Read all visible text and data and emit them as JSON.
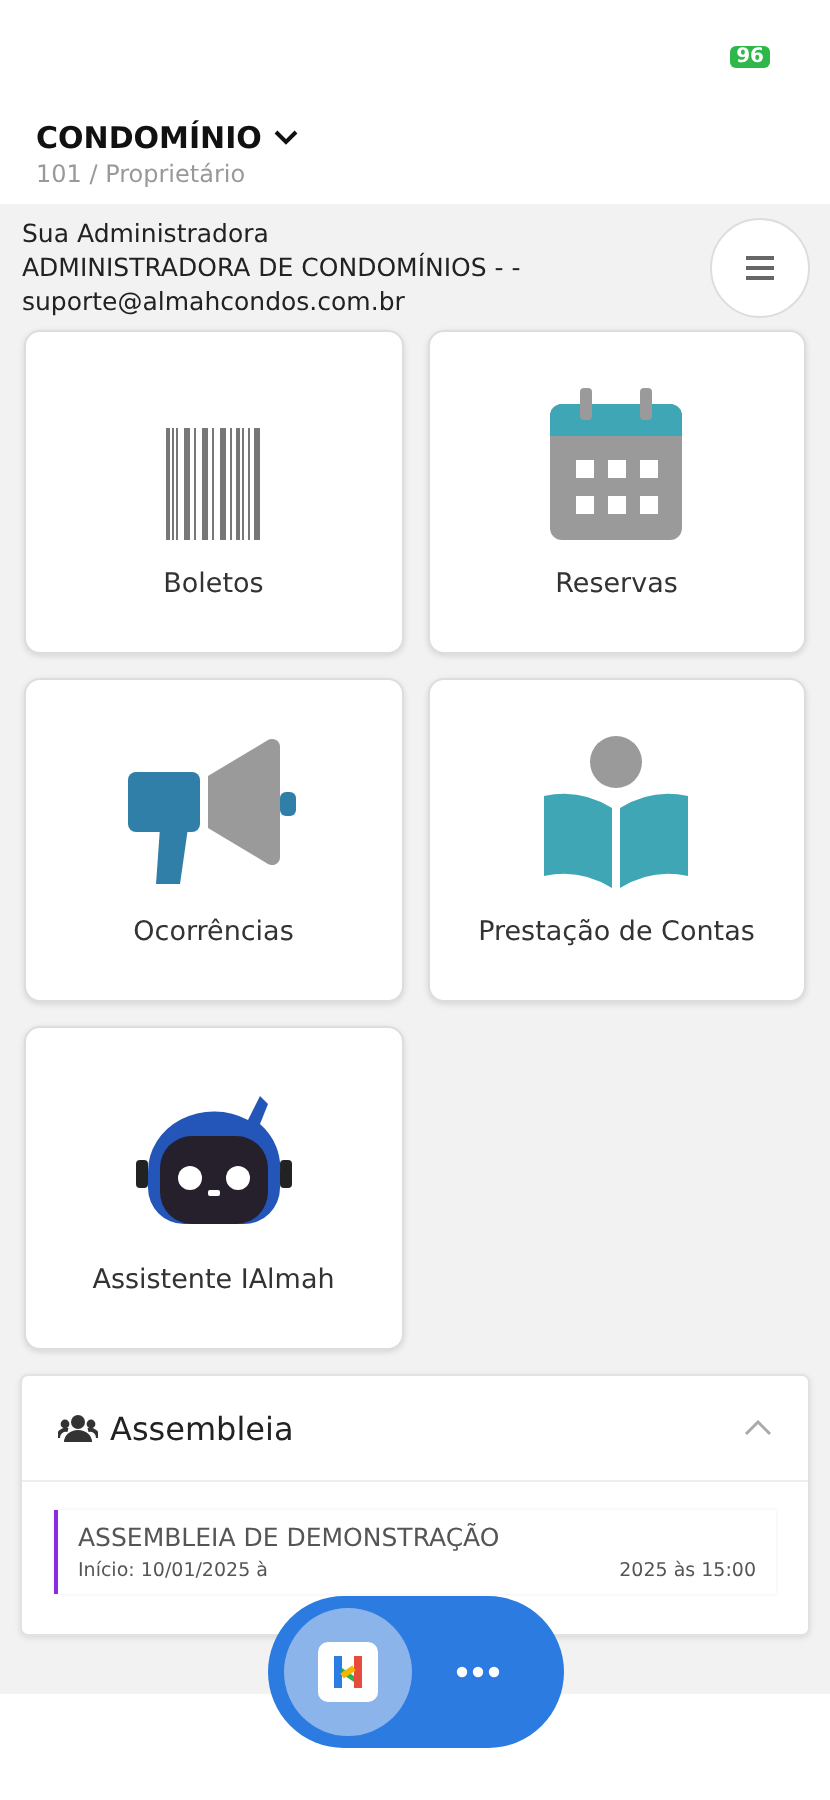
{
  "status_bar": {
    "battery": "96"
  },
  "header": {
    "title": "CONDOMÍNIO",
    "subtitle": "101 / Proprietário"
  },
  "administrator": {
    "label": "Sua Administradora",
    "name": "ADMINISTRADORA DE CONDOMÍNIOS - -",
    "email": "suporte@almahcondos.com.br"
  },
  "tiles": [
    {
      "kind": "barcode",
      "label": "Boletos"
    },
    {
      "kind": "calendar",
      "label": "Reservas"
    },
    {
      "kind": "megaphone",
      "label": "Ocorrências"
    },
    {
      "kind": "book",
      "label": "Prestação de Contas"
    },
    {
      "kind": "robot",
      "label": "Assistente IAlmah"
    }
  ],
  "assembly": {
    "title": "Assembleia",
    "expanded": true,
    "items": [
      {
        "title": "ASSEMBLEIA DE DEMONSTRAÇÃO",
        "dates_start": "Início: 10/01/2025 à",
        "dates_end": "2025 às 15:00"
      }
    ]
  }
}
